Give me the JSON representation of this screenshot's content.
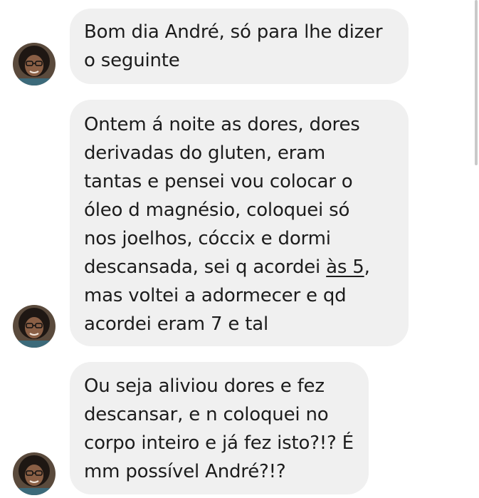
{
  "messages": [
    {
      "lines": [
        "Bom dia André, só para lhe dizer",
        "o seguinte"
      ]
    },
    {
      "lines": [
        "Ontem á noite as dores, dores",
        "derivadas do gluten, eram",
        "tantas e pensei vou colocar o",
        "óleo d magnésio, coloquei só",
        "nos joelhos, cóccix e dormi",
        "descansada, sei q acordei ",
        "mas voltei a adormecer e qd",
        "acordei eram 7 e tal"
      ],
      "link_text": "às 5",
      "after_link": ","
    },
    {
      "lines": [
        "Ou seja aliviou dores e fez",
        "descansar, e n coloquei no",
        "corpo inteiro e já fez isto?!? É",
        "mm possível André?!?"
      ]
    }
  ],
  "colors": {
    "bubble_background": "#f0f0f0",
    "text": "#1c1c1c",
    "scrollbar": "#c9c9c9"
  },
  "icons": {
    "avatar": "sender-avatar-photo"
  }
}
